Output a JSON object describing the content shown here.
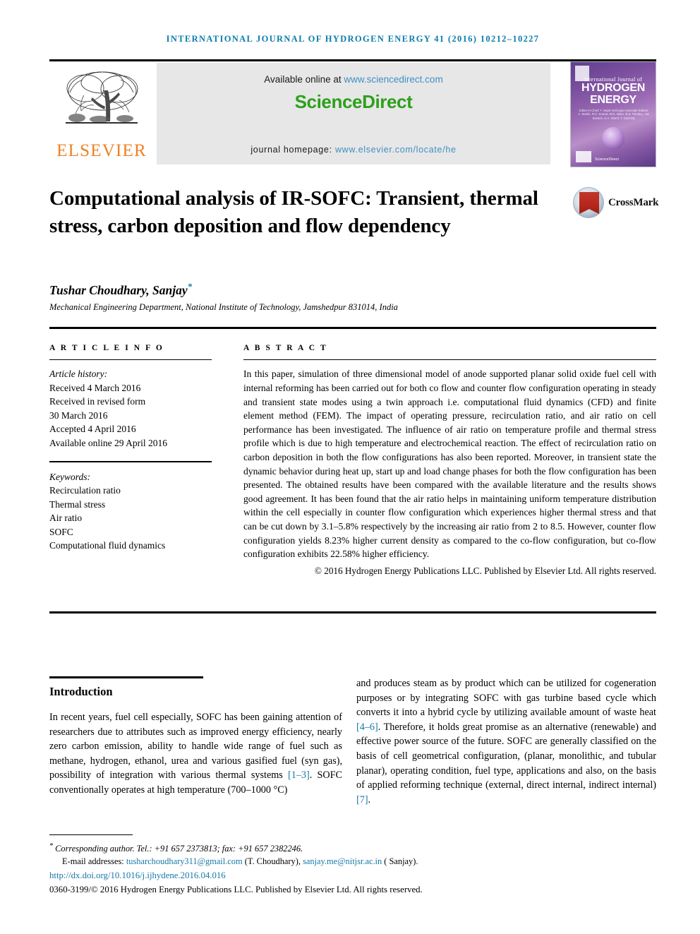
{
  "running_head": "International Journal of Hydrogen Energy 41 (2016) 10212–10227",
  "masthead": {
    "publisher_name": "ELSEVIER",
    "available_prefix": "Available online at ",
    "available_url": "www.sciencedirect.com",
    "sciencedirect_logo": "ScienceDirect",
    "homepage_prefix": "journal homepage: ",
    "homepage_url": "www.elsevier.com/locate/he",
    "cover": {
      "line1": "International Journal of",
      "line2": "HYDROGEN",
      "line3": "ENERGY",
      "editors": "Editor-in-Chief: T. Nejat Veziroglu  Associate Editors: A. Bashir, R.C. Kumar, M.R. Islam, B.D. Pandey, J.M. Bockris, S.A. Sherif, T. Ould-Ely",
      "sciencedirect": "ScienceDirect"
    }
  },
  "article": {
    "title": "Computational analysis of IR-SOFC: Transient, thermal stress, carbon deposition and flow dependency",
    "crossmark_label": "CrossMark",
    "authors": "Tushar Choudhary,  Sanjay",
    "corresponding_marker": "*",
    "affiliation": "Mechanical Engineering Department, National Institute of Technology, Jamshedpur 831014, India"
  },
  "article_info": {
    "label": "A R T I C L E   I N F O",
    "history_heading": "Article history:",
    "history": [
      "Received 4 March 2016",
      "Received in revised form",
      "30 March 2016",
      "Accepted 4 April 2016",
      "Available online 29 April 2016"
    ],
    "keywords_heading": "Keywords:",
    "keywords": [
      "Recirculation ratio",
      "Thermal stress",
      "Air ratio",
      "SOFC",
      "Computational fluid dynamics"
    ]
  },
  "abstract": {
    "label": "A B S T R A C T",
    "text": "In this paper, simulation of three dimensional model of anode supported planar solid oxide fuel cell with internal reforming has been carried out for both co flow and counter flow configuration operating in steady and transient state modes using a twin approach i.e. computational fluid dynamics (CFD) and finite element method (FEM). The impact of operating pressure, recirculation ratio, and air ratio on cell performance has been investigated. The influence of air ratio on temperature profile and thermal stress profile which is due to high temperature and electrochemical reaction. The effect of recirculation ratio on carbon deposition in both the flow configurations has also been reported. Moreover, in transient state the dynamic behavior during heat up, start up and load change phases for both the flow configuration has been presented. The obtained results have been compared with the available literature and the results shows good agreement. It has been found that the air ratio helps in maintaining uniform temperature distribution within the cell especially in counter flow configuration which experiences higher thermal stress and that can be cut down by 3.1–5.8% respectively by the increasing air ratio from 2 to 8.5. However, counter flow configuration yields 8.23% higher current density as compared to the co-flow configuration, but co-flow configuration exhibits 22.58% higher efficiency.",
    "copyright": "© 2016 Hydrogen Energy Publications LLC. Published by Elsevier Ltd. All rights reserved."
  },
  "introduction": {
    "heading": "Introduction",
    "left_part1": "In recent years, fuel cell especially, SOFC has been gaining attention of researchers due to attributes such as improved energy efficiency, nearly zero carbon emission, ability to handle wide range of fuel such as methane, hydrogen, ethanol, urea and various gasified fuel (syn gas), possibility of integration with various thermal systems ",
    "left_ref1": "[1–3]",
    "left_part2": ". SOFC conventionally operates at high temperature (700–1000 °C)",
    "right_part1": "and produces steam as by product which can be utilized for cogeneration purposes or by integrating SOFC with gas turbine based cycle which converts it into a hybrid cycle by utilizing available amount of waste heat ",
    "right_ref1": "[4–6]",
    "right_part2": ". Therefore, it holds great promise as an alternative (renewable) and effective power source of the future. SOFC are generally classified on the basis of cell geometrical configuration, (planar, monolithic, and tubular planar), operating condition, fuel type, applications and also, on the basis of applied reforming technique (external, direct internal, indirect internal) ",
    "right_ref2": "[7]",
    "right_part3": "."
  },
  "footer": {
    "corresponding": "Corresponding author. Tel.: +91 657 2373813; fax: +91 657 2382246.",
    "email_label": "E-mail addresses: ",
    "email1": "tusharchoudhary311@gmail.com",
    "email1_owner": " (T. Choudhary), ",
    "email2": "sanjay.me@nitjsr.ac.in",
    "email2_owner": " ( Sanjay).",
    "doi": "http://dx.doi.org/10.1016/j.ijhydene.2016.04.016",
    "issn_copyright": "0360-3199/© 2016 Hydrogen Energy Publications LLC. Published by Elsevier Ltd. All rights reserved."
  },
  "colors": {
    "journal_blue": "#0b7cab",
    "link_blue": "#1878a8",
    "sciencedirect_green": "#2ca01c",
    "elsevier_orange": "#f08122",
    "banner_gray": "#e7e7e7"
  }
}
